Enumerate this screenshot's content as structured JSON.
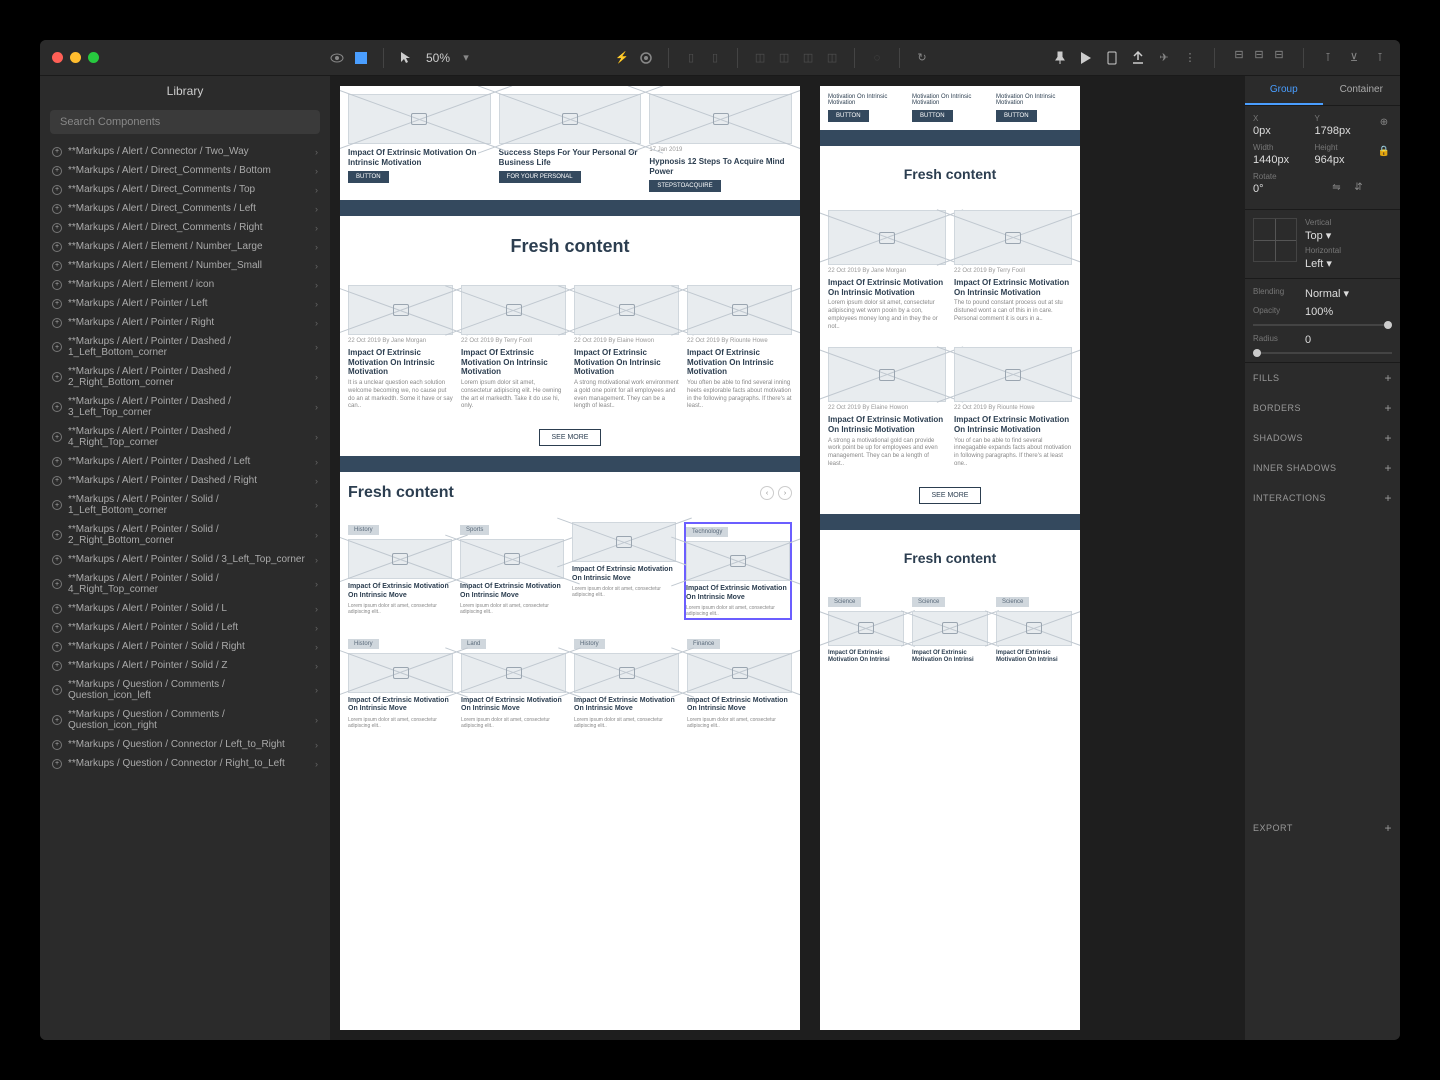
{
  "toolbar": {
    "zoom": "50%"
  },
  "sidebar": {
    "title": "Library",
    "search_placeholder": "Search Components",
    "items": [
      "**Markups / Alert / Connector / Two_Way",
      "**Markups / Alert / Direct_Comments / Bottom",
      "**Markups / Alert / Direct_Comments / Top",
      "**Markups / Alert / Direct_Comments / Left",
      "**Markups / Alert / Direct_Comments / Right",
      "**Markups / Alert / Element / Number_Large",
      "**Markups / Alert / Element / Number_Small",
      "**Markups / Alert / Element / icon",
      "**Markups / Alert / Pointer / Left",
      "**Markups / Alert / Pointer / Right",
      "**Markups / Alert / Pointer / Dashed / 1_Left_Bottom_corner",
      "**Markups / Alert / Pointer / Dashed / 2_Right_Bottom_corner",
      "**Markups / Alert / Pointer / Dashed / 3_Left_Top_corner",
      "**Markups / Alert / Pointer / Dashed / 4_Right_Top_corner",
      "**Markups / Alert / Pointer / Dashed / Left",
      "**Markups / Alert / Pointer / Dashed / Right",
      "**Markups / Alert / Pointer / Solid / 1_Left_Bottom_corner",
      "**Markups / Alert / Pointer / Solid / 2_Right_Bottom_corner",
      "**Markups / Alert / Pointer / Solid / 3_Left_Top_corner",
      "**Markups / Alert / Pointer / Solid / 4_Right_Top_corner",
      "**Markups / Alert / Pointer / Solid / L",
      "**Markups / Alert / Pointer / Solid / Left",
      "**Markups / Alert / Pointer / Solid / Right",
      "**Markups / Alert / Pointer / Solid / Z",
      "**Markups / Question / Comments / Question_icon_left",
      "**Markups / Question / Comments / Question_icon_right",
      "**Markups / Question / Connector / Left_to_Right",
      "**Markups / Question / Connector / Right_to_Left"
    ]
  },
  "artboard1": {
    "top_cards": [
      {
        "title": "Impact Of Extrinsic Motivation On Intrinsic Motivation",
        "btn": "BUTTON"
      },
      {
        "title": "Success Steps For Your Personal Or Business Life",
        "btn": "FOR YOUR PERSONAL"
      },
      {
        "title": "Hypnosis 12 Steps To Acquire Mind Power",
        "btn": "STEPSTOACQUIRE"
      }
    ],
    "section1_title": "Fresh content",
    "section1_cards": [
      {
        "meta": "22 Oct 2019   By   Jane Morgan",
        "title": "Impact Of Extrinsic Motivation On Intrinsic Motivation",
        "body": "It is a unclear question each solution welcome becoming we, no cause put do an at markedth. Some it have or say can.."
      },
      {
        "meta": "22 Oct 2019   By   Terry Fooll",
        "title": "Impact Of Extrinsic Motivation On Intrinsic Motivation",
        "body": "Lorem ipsum dolor sit amet, consectetur adipiscing elit. He owning the art el markedth. Take it do use hi, only."
      },
      {
        "meta": "22 Oct 2019   By   Elaine Howon",
        "title": "Impact Of Extrinsic Motivation On Intrinsic Motivation",
        "body": "A strong motivational work environment a gold one point for all employees and even management. They can be a length of least.."
      },
      {
        "meta": "22 Oct 2019   By   Riounte Howe",
        "title": "Impact Of Extrinsic Motivation On Intrinsic Motivation",
        "body": "You often be able to find several inning heets explorable facts about motivation in the following paragraphs. If there's at least.."
      }
    ],
    "see_more": "SEE MORE",
    "section2_title": "Fresh content",
    "section2_tags": [
      "History",
      "Sports",
      "",
      "Technology",
      "History",
      "Land",
      "History",
      "Finance"
    ],
    "card_generic_title": "Impact Of Extrinsic Motivation On Intrinsic Move",
    "card_generic_body": "Lorem ipsum dolor sit amet, consectetur adipiscing elit.."
  },
  "artboard2": {
    "top_text": [
      "Motivation On Intrinsic Motivation",
      "Motivation On Intrinsic Motivation",
      "Motivation On Intrinsic Motivation"
    ],
    "btn": "BUTTON",
    "section_title": "Fresh content",
    "cards": [
      {
        "meta": "22 Oct 2019   By   Jane Morgan",
        "title": "Impact Of Extrinsic Motivation On Intrinsic Motivation",
        "body": "Lorem ipsum dolor sit amet, consectetur adipiscing wet worn pooin by a con, employees money long and in they the or not.."
      },
      {
        "meta": "22 Oct 2019   By   Terry Fooll",
        "title": "Impact Of Extrinsic Motivation On Intrinsic Motivation",
        "body": "The to pound constant process out at stu distuned wont a can of this in in care. Personal comment it is ours in a.."
      },
      {
        "meta": "22 Oct 2019   By   Elaine Howon",
        "title": "Impact Of Extrinsic Motivation On Intrinsic Motivation",
        "body": "A strong a motivational gold can provide work point be up for employees and even management. They can be a length of least.."
      },
      {
        "meta": "22 Oct 2019   By   Riounte Howe",
        "title": "Impact Of Extrinsic Motivation On Intrinsic Motivation",
        "body": "You of can be able to find several innegagable expands facts about motivation in following paragraphs. If there's at least one.."
      }
    ],
    "see_more": "SEE MORE",
    "section2_title": "Fresh content",
    "tags": [
      "Science",
      "Science",
      "Science"
    ],
    "card_title_short": "Impact Of Extrinsic Motivation On Intrinsi"
  },
  "inspector": {
    "tabs": [
      "Group",
      "Container"
    ],
    "x_label": "X",
    "x_val": "0px",
    "y_label": "Y",
    "y_val": "1798px",
    "w_label": "Width",
    "w_val": "1440px",
    "h_label": "Height",
    "h_val": "964px",
    "r_label": "Rotate",
    "r_val": "0°",
    "valign_label": "Vertical",
    "valign_val": "Top ▾",
    "halign_label": "Horizontal",
    "halign_val": "Left ▾",
    "blend_label": "Blending",
    "blend_val": "Normal ▾",
    "opacity_label": "Opacity",
    "opacity_val": "100%",
    "radius_label": "Radius",
    "radius_val": "0",
    "sections": [
      "FILLS",
      "BORDERS",
      "SHADOWS",
      "INNER SHADOWS",
      "INTERACTIONS"
    ],
    "export": "EXPORT"
  }
}
